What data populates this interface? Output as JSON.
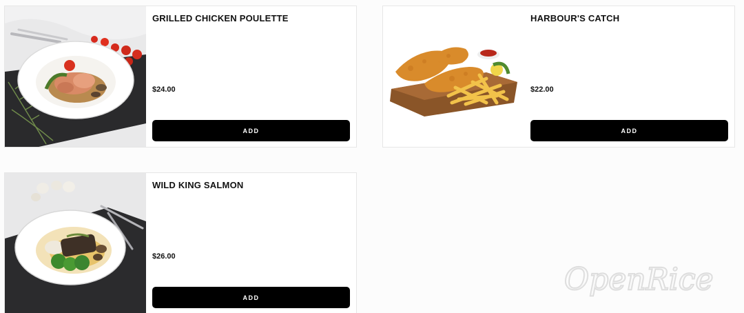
{
  "menu": {
    "items": [
      {
        "name": "GRILLED CHICKEN POULETTE",
        "price": "$24.00",
        "add_label": "ADD"
      },
      {
        "name": "HARBOUR'S CATCH",
        "price": "$22.00",
        "add_label": "ADD"
      },
      {
        "name": "WILD KING SALMON",
        "price": "$26.00",
        "add_label": "ADD"
      }
    ]
  },
  "watermark": {
    "text": "OpenRice"
  }
}
